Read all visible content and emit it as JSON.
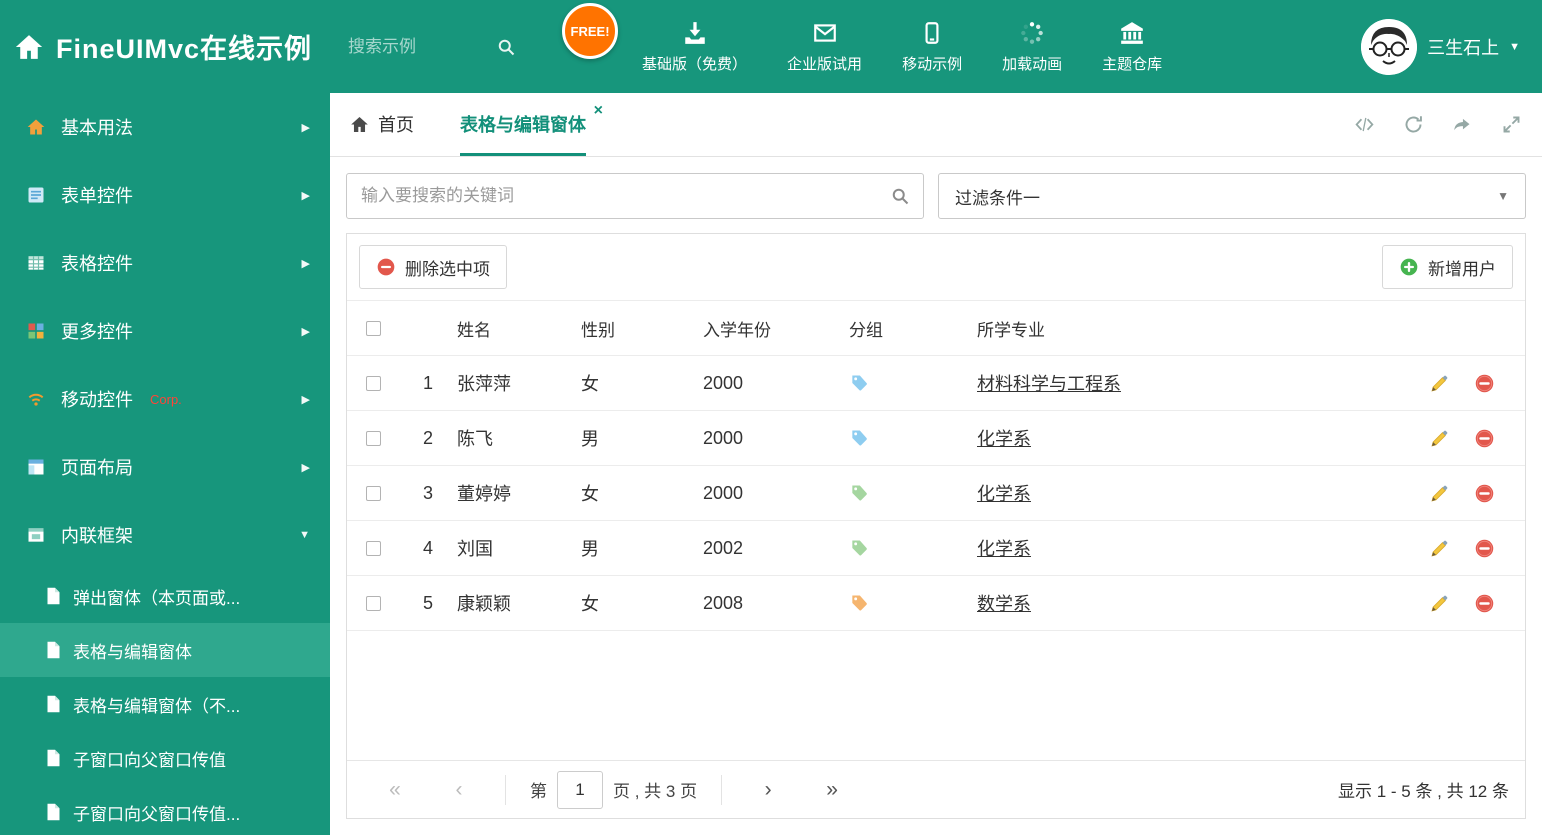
{
  "colors": {
    "theme_green": "#17967c",
    "sidebar_active": "#2fa88e",
    "tab_active": "#13907a",
    "free_badge_orange": "#ff7300",
    "delete_red": "#e2574c",
    "add_green": "#46b450",
    "pencil_yellow": "#f3c73e"
  },
  "icons": {
    "caret_down": "▼",
    "chevron_right": "▶",
    "chevron_down": "▼",
    "close": "×",
    "first": "«",
    "prev": "‹",
    "next": "›",
    "last": "»"
  },
  "header": {
    "title": "FineUIMvc在线示例",
    "search_placeholder": "搜索示例",
    "free_badge": "FREE!",
    "nav_items": [
      {
        "label": "基础版（免费）",
        "icon": "download-icon"
      },
      {
        "label": "企业版试用",
        "icon": "envelope-icon"
      },
      {
        "label": "移动示例",
        "icon": "mobile-icon"
      },
      {
        "label": "加载动画",
        "icon": "spinner-icon"
      },
      {
        "label": "主题仓库",
        "icon": "bank-icon"
      }
    ],
    "username": "三生石上"
  },
  "sidebar": {
    "items": [
      {
        "label": "基本用法",
        "icon": "home-colored-icon",
        "state": "collapsed"
      },
      {
        "label": "表单控件",
        "icon": "form-icon",
        "state": "collapsed"
      },
      {
        "label": "表格控件",
        "icon": "table-icon",
        "state": "collapsed"
      },
      {
        "label": "更多控件",
        "icon": "widgets-icon",
        "state": "collapsed"
      },
      {
        "label": "移动控件",
        "icon": "mobile-signal-icon",
        "badge": "Corp.",
        "state": "collapsed"
      },
      {
        "label": "页面布局",
        "icon": "layout-icon",
        "state": "collapsed"
      },
      {
        "label": "内联框架",
        "icon": "iframe-icon",
        "state": "expanded"
      }
    ],
    "subitems": [
      {
        "label": "弹出窗体（本页面或...",
        "active": false
      },
      {
        "label": "表格与编辑窗体",
        "active": true
      },
      {
        "label": "表格与编辑窗体（不...",
        "active": false
      },
      {
        "label": "子窗口向父窗口传值",
        "active": false
      },
      {
        "label": "子窗口向父窗口传值...",
        "active": false
      }
    ]
  },
  "tabbar": {
    "tabs": [
      {
        "label": "首页",
        "icon": "home-icon",
        "active": false,
        "closable": false
      },
      {
        "label": "表格与编辑窗体",
        "icon": "",
        "active": true,
        "closable": true
      }
    ],
    "actions": [
      "code-icon",
      "refresh-icon",
      "share-icon",
      "fullscreen-icon"
    ]
  },
  "filters": {
    "search_placeholder": "输入要搜索的关键词",
    "filter_value": "过滤条件一"
  },
  "toolbar": {
    "delete_label": "删除选中项",
    "add_label": "新增用户"
  },
  "table": {
    "headers": [
      "姓名",
      "性别",
      "入学年份",
      "分组",
      "所学专业"
    ],
    "rows": [
      {
        "num": "1",
        "name": "张萍萍",
        "gender": "女",
        "year": "2000",
        "tag_color": "#8ecdf0",
        "major": "材料科学与工程系"
      },
      {
        "num": "2",
        "name": "陈飞",
        "gender": "男",
        "year": "2000",
        "tag_color": "#8ecdf0",
        "major": "化学系"
      },
      {
        "num": "3",
        "name": "董婷婷",
        "gender": "女",
        "year": "2000",
        "tag_color": "#a5d6a0",
        "major": "化学系"
      },
      {
        "num": "4",
        "name": "刘国",
        "gender": "男",
        "year": "2002",
        "tag_color": "#a5d6a0",
        "major": "化学系"
      },
      {
        "num": "5",
        "name": "康颖颖",
        "gender": "女",
        "year": "2008",
        "tag_color": "#f5b56f",
        "major": "数学系"
      }
    ]
  },
  "pagination": {
    "page_prefix": "第",
    "page_value": "1",
    "page_suffix": "页 , 共 3 页",
    "summary": "显示 1 - 5 条 , 共 12 条"
  }
}
